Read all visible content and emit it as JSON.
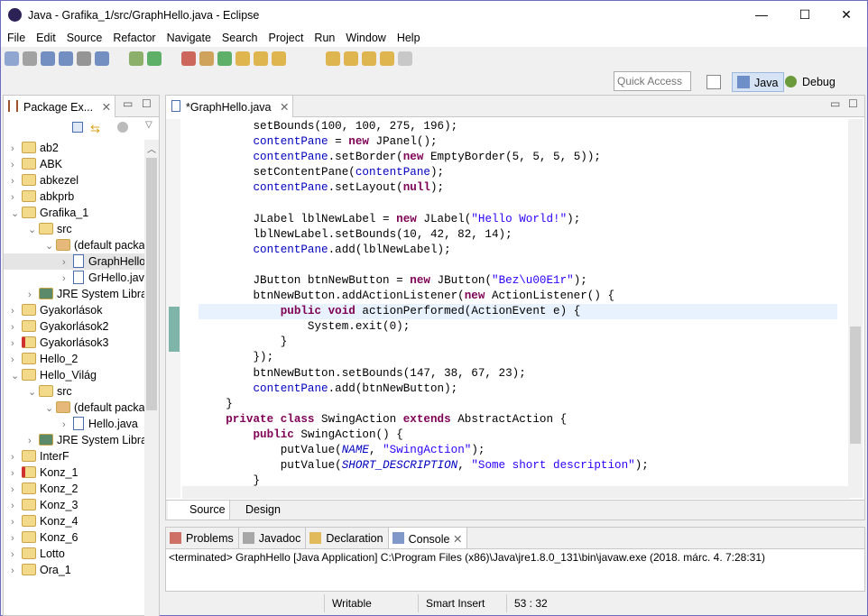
{
  "window": {
    "title": "Java - Grafika_1/src/GraphHello.java - Eclipse",
    "minimize": "—",
    "maximize": "☐",
    "close": "✕"
  },
  "menu": [
    "File",
    "Edit",
    "Source",
    "Refactor",
    "Navigate",
    "Search",
    "Project",
    "Run",
    "Window",
    "Help"
  ],
  "quick_access": {
    "placeholder": "Quick Access"
  },
  "perspectives": [
    {
      "label": "Java",
      "active": true
    },
    {
      "label": "Debug",
      "active": false
    }
  ],
  "package_explorer": {
    "title": "Package Ex...",
    "items": [
      {
        "label": "ab2",
        "depth": 0,
        "exp": ">",
        "icon": "project"
      },
      {
        "label": "ABK",
        "depth": 0,
        "exp": ">",
        "icon": "project-warning"
      },
      {
        "label": "abkezel",
        "depth": 0,
        "exp": ">",
        "icon": "project-warning"
      },
      {
        "label": "abkprb",
        "depth": 0,
        "exp": ">",
        "icon": "project"
      },
      {
        "label": "Grafika_1",
        "depth": 0,
        "exp": "v",
        "icon": "project-warning"
      },
      {
        "label": "src",
        "depth": 1,
        "exp": "v",
        "icon": "source-folder"
      },
      {
        "label": "(default package)",
        "depth": 2,
        "exp": "v",
        "icon": "package"
      },
      {
        "label": "GraphHello.java",
        "depth": 3,
        "exp": ">",
        "icon": "java-file",
        "selected": true
      },
      {
        "label": "GrHello.java",
        "depth": 3,
        "exp": ">",
        "icon": "java-file"
      },
      {
        "label": "JRE System Library",
        "depth": 1,
        "exp": ">",
        "icon": "library"
      },
      {
        "label": "Gyakorlások",
        "depth": 0,
        "exp": ">",
        "icon": "project-warning"
      },
      {
        "label": "Gyakorlások2",
        "depth": 0,
        "exp": ">",
        "icon": "project-warning"
      },
      {
        "label": "Gyakorlások3",
        "depth": 0,
        "exp": ">",
        "icon": "project-error"
      },
      {
        "label": "Hello_2",
        "depth": 0,
        "exp": ">",
        "icon": "project-warning"
      },
      {
        "label": "Hello_Világ",
        "depth": 0,
        "exp": "v",
        "icon": "project-warning"
      },
      {
        "label": "src",
        "depth": 1,
        "exp": "v",
        "icon": "source-folder"
      },
      {
        "label": "(default package)",
        "depth": 2,
        "exp": "v",
        "icon": "package"
      },
      {
        "label": "Hello.java",
        "depth": 3,
        "exp": ">",
        "icon": "java-file"
      },
      {
        "label": "JRE System Library",
        "depth": 1,
        "exp": ">",
        "icon": "library"
      },
      {
        "label": "InterF",
        "depth": 0,
        "exp": ">",
        "icon": "project"
      },
      {
        "label": "Konz_1",
        "depth": 0,
        "exp": ">",
        "icon": "project-error"
      },
      {
        "label": "Konz_2",
        "depth": 0,
        "exp": ">",
        "icon": "project"
      },
      {
        "label": "Konz_3",
        "depth": 0,
        "exp": ">",
        "icon": "project"
      },
      {
        "label": "Konz_4",
        "depth": 0,
        "exp": ">",
        "icon": "project"
      },
      {
        "label": "Konz_6",
        "depth": 0,
        "exp": ">",
        "icon": "project"
      },
      {
        "label": "Lotto",
        "depth": 0,
        "exp": ">",
        "icon": "project"
      },
      {
        "label": "Ora_1",
        "depth": 0,
        "exp": ">",
        "icon": "project"
      }
    ]
  },
  "editor": {
    "tab": "*GraphHello.java",
    "bottom_tabs": [
      "Source",
      "Design"
    ],
    "current_line": 13,
    "lines": [
      [
        [
          "        setBounds(100, 100, 275, 196);",
          ""
        ]
      ],
      [
        [
          "        ",
          ""
        ],
        [
          "contentPane",
          "fd"
        ],
        [
          " = ",
          ""
        ],
        [
          "new",
          "kw"
        ],
        [
          " JPanel();",
          ""
        ]
      ],
      [
        [
          "        ",
          ""
        ],
        [
          "contentPane",
          "fd"
        ],
        [
          ".setBorder(",
          ""
        ],
        [
          "new",
          "kw"
        ],
        [
          " EmptyBorder(5, 5, 5, 5));",
          ""
        ]
      ],
      [
        [
          "        setContentPane(",
          ""
        ],
        [
          "contentPane",
          "fd"
        ],
        [
          ");",
          ""
        ]
      ],
      [
        [
          "        ",
          ""
        ],
        [
          "contentPane",
          "fd"
        ],
        [
          ".setLayout(",
          ""
        ],
        [
          "null",
          "kw"
        ],
        [
          ");",
          ""
        ]
      ],
      [
        [
          "",
          ""
        ]
      ],
      [
        [
          "        JLabel lblNewLabel = ",
          ""
        ],
        [
          "new",
          "kw"
        ],
        [
          " JLabel(",
          ""
        ],
        [
          "\"Hello World!\"",
          "st"
        ],
        [
          ");",
          ""
        ]
      ],
      [
        [
          "        lblNewLabel.setBounds(10, 42, 82, 14);",
          ""
        ]
      ],
      [
        [
          "        ",
          ""
        ],
        [
          "contentPane",
          "fd"
        ],
        [
          ".add(lblNewLabel);",
          ""
        ]
      ],
      [
        [
          "",
          ""
        ]
      ],
      [
        [
          "        JButton btnNewButton = ",
          ""
        ],
        [
          "new",
          "kw"
        ],
        [
          " JButton(",
          ""
        ],
        [
          "\"Bez\\u00E1r\"",
          "st"
        ],
        [
          ");",
          ""
        ]
      ],
      [
        [
          "        btnNewButton.addActionListener(",
          ""
        ],
        [
          "new",
          "kw"
        ],
        [
          " ActionListener() {",
          ""
        ]
      ],
      [
        [
          "            ",
          ""
        ],
        [
          "public",
          "kw"
        ],
        [
          " ",
          ""
        ],
        [
          "void",
          "kw"
        ],
        [
          " actionPerformed(ActionEvent e) {",
          ""
        ]
      ],
      [
        [
          "                System.exit(0);",
          ""
        ]
      ],
      [
        [
          "            }",
          ""
        ]
      ],
      [
        [
          "        });",
          ""
        ]
      ],
      [
        [
          "        btnNewButton.setBounds(147, 38, 67, 23);",
          ""
        ]
      ],
      [
        [
          "        ",
          ""
        ],
        [
          "contentPane",
          "fd"
        ],
        [
          ".add(btnNewButton);",
          ""
        ]
      ],
      [
        [
          "    }",
          ""
        ]
      ],
      [
        [
          "    ",
          ""
        ],
        [
          "private",
          "kw"
        ],
        [
          " ",
          ""
        ],
        [
          "class",
          "kw"
        ],
        [
          " SwingAction ",
          ""
        ],
        [
          "extends",
          "kw"
        ],
        [
          " AbstractAction {",
          ""
        ]
      ],
      [
        [
          "        ",
          ""
        ],
        [
          "public",
          "kw"
        ],
        [
          " SwingAction() {",
          ""
        ]
      ],
      [
        [
          "            putValue(",
          ""
        ],
        [
          "NAME",
          "sf"
        ],
        [
          ", ",
          ""
        ],
        [
          "\"SwingAction\"",
          "st"
        ],
        [
          ");",
          ""
        ]
      ],
      [
        [
          "            putValue(",
          ""
        ],
        [
          "SHORT_DESCRIPTION",
          "sf"
        ],
        [
          ", ",
          ""
        ],
        [
          "\"Some short description\"",
          "st"
        ],
        [
          ");",
          ""
        ]
      ],
      [
        [
          "        }",
          ""
        ]
      ]
    ]
  },
  "console": {
    "tabs": [
      "Problems",
      "Javadoc",
      "Declaration",
      "Console"
    ],
    "active_tab": "Console",
    "text": "<terminated> GraphHello [Java Application] C:\\Program Files (x86)\\Java\\jre1.8.0_131\\bin\\javaw.exe (2018. márc. 4. 7:28:31)"
  },
  "status": {
    "mode": "Writable",
    "insert": "Smart Insert",
    "position": "53 : 32"
  },
  "colors": {
    "keyword": "#7f0055",
    "field": "#0000c0",
    "string": "#2a00ff",
    "current_line": "#e8f2fe"
  }
}
